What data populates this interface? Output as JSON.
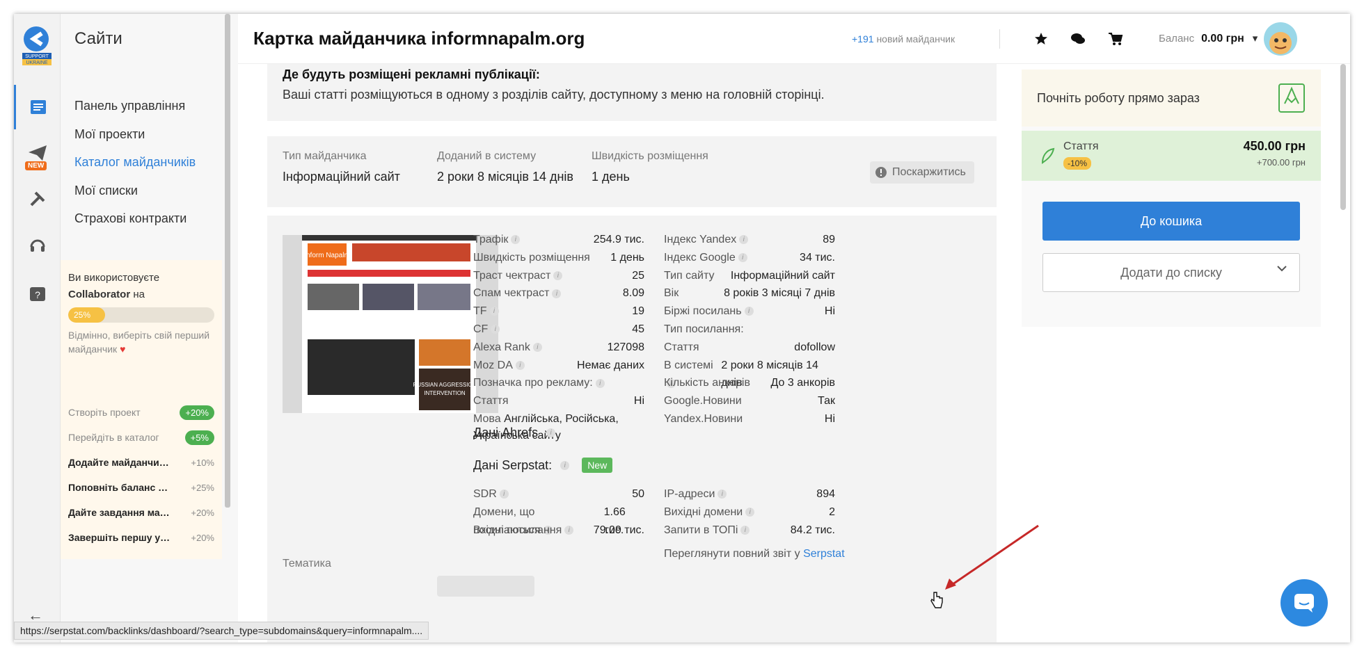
{
  "sidebar": {
    "title": "Сайти",
    "logo_text": "SUPPORT UKRAINE",
    "new_badge": "NEW",
    "items": [
      {
        "label": "Панель управління"
      },
      {
        "label": "Мої проекти"
      },
      {
        "label": "Каталог майданчиків"
      },
      {
        "label": "Мої списки"
      },
      {
        "label": "Страхові контракти"
      }
    ],
    "collab": {
      "line1": "Ви використовуєте",
      "product": "Collaborator",
      "line1_end": "на",
      "progress_label": "25%",
      "progress": 0.25,
      "hint": "Відмінно, виберіть свій перший майданчик"
    },
    "tasks": [
      {
        "label": "Створіть проект",
        "reward": "+20%"
      },
      {
        "label": "Перейдіть в каталог",
        "reward": "+5%"
      },
      {
        "label": "Додайте майданчик д...",
        "reward": "+10%"
      },
      {
        "label": "Поповніть баланс у с...",
        "reward": "+25%"
      },
      {
        "label": "Дайте завдання майд...",
        "reward": "+20%"
      },
      {
        "label": "Завершіть першу уго...",
        "reward": "+20%"
      }
    ]
  },
  "status_url": "https://serpstat.com/backlinks/dashboard/?search_type=subdomains&query=informnapalm....",
  "header": {
    "title": "Картка майданчика informnapalm.org",
    "new_count": "+191",
    "new_text": "новий майданчик",
    "balance_label": "Баланс",
    "balance_value": "0.00 грн"
  },
  "publication": {
    "question": "Де будуть розміщені рекламні публікації:",
    "answer": "Ваші статті розміщуються в одному з розділів сайту, доступному з меню на головній сторінці."
  },
  "meta": {
    "type_label": "Тип майданчика",
    "type_value": "Інформаційний сайт",
    "added_label": "Доданий в систему",
    "added_value": "2 роки 8 місяців 14 днів",
    "speed_label": "Швидкість розміщення",
    "speed_value": "1 день",
    "complain": "Поскаржитись"
  },
  "thumb": {
    "logo": "Inform Napalm",
    "headline": "RUSSIAN AGGRESSION",
    "sub": "INTERVENTION"
  },
  "stats_left": [
    {
      "k": "Трафік",
      "v": "254.9 тис."
    },
    {
      "k": "Швидкість розміщення",
      "v": "1 день"
    },
    {
      "k": "Траст чектраст",
      "v": "25"
    },
    {
      "k": "Спам чектраст",
      "v": "8.09"
    },
    {
      "k": "TF",
      "v": "19"
    },
    {
      "k": "CF",
      "v": "45"
    },
    {
      "k": "Alexa Rank",
      "v": "127098"
    },
    {
      "k": "Moz DA",
      "v": "Немає даних"
    },
    {
      "k": "Позначка про рекламу:",
      "v": ""
    },
    {
      "k": "Стаття",
      "v": "Ні"
    }
  ],
  "language": {
    "k": "Мова",
    "v": "Англійська, Російська, Українська сайту"
  },
  "stats_right": [
    {
      "k": "Індекс Yandex",
      "v": "89"
    },
    {
      "k": "Індекс Google",
      "v": "34 тис."
    },
    {
      "k": "Тип сайту",
      "v": "Інформаційний сайт"
    },
    {
      "k": "Вік",
      "v": "8 років 3 місяці 7 днів"
    },
    {
      "k": "Біржі посилань",
      "v": "Ні"
    },
    {
      "k": "Тип посилання:",
      "v": ""
    },
    {
      "k": "Стаття",
      "v": "dofollow"
    },
    {
      "k": "В системі",
      "v": "2 роки 8 місяців 14 днів"
    },
    {
      "k": "Кількість анкорів",
      "v": "До 3 анкорів"
    },
    {
      "k": "Google.Новини",
      "v": "Так"
    },
    {
      "k": "Yandex.Новини",
      "v": "Ні"
    }
  ],
  "ahrefs": {
    "label": "Дані Ahrefs"
  },
  "serpstat": {
    "label": "Дані Serpstat:",
    "badge": "New",
    "left": [
      {
        "k": "SDR",
        "v": "50"
      },
      {
        "k": "Домени, що посилаються",
        "v": "1.66 тис."
      },
      {
        "k": "Вхідні посилання",
        "v": "79.09 тис."
      }
    ],
    "right": [
      {
        "k": "IP-адреси",
        "v": "894"
      },
      {
        "k": "Вихідні домени",
        "v": "2"
      },
      {
        "k": "Запити в ТОПі",
        "v": "84.2 тис."
      }
    ],
    "report_text": "Переглянути повний звіт у",
    "report_link": "Serpstat"
  },
  "subject_label": "Тематика",
  "right_panel": {
    "start": "Почніть роботу прямо зараз",
    "product": "Стаття",
    "discount": "-10%",
    "price": "450.00 грн",
    "old_price": "+700.00 грн",
    "cart_button": "До кошика",
    "list_button": "Додати до списку"
  },
  "colors": {
    "accent": "#2f80d8",
    "green": "#5cb85c",
    "warning": "#f6c144"
  }
}
